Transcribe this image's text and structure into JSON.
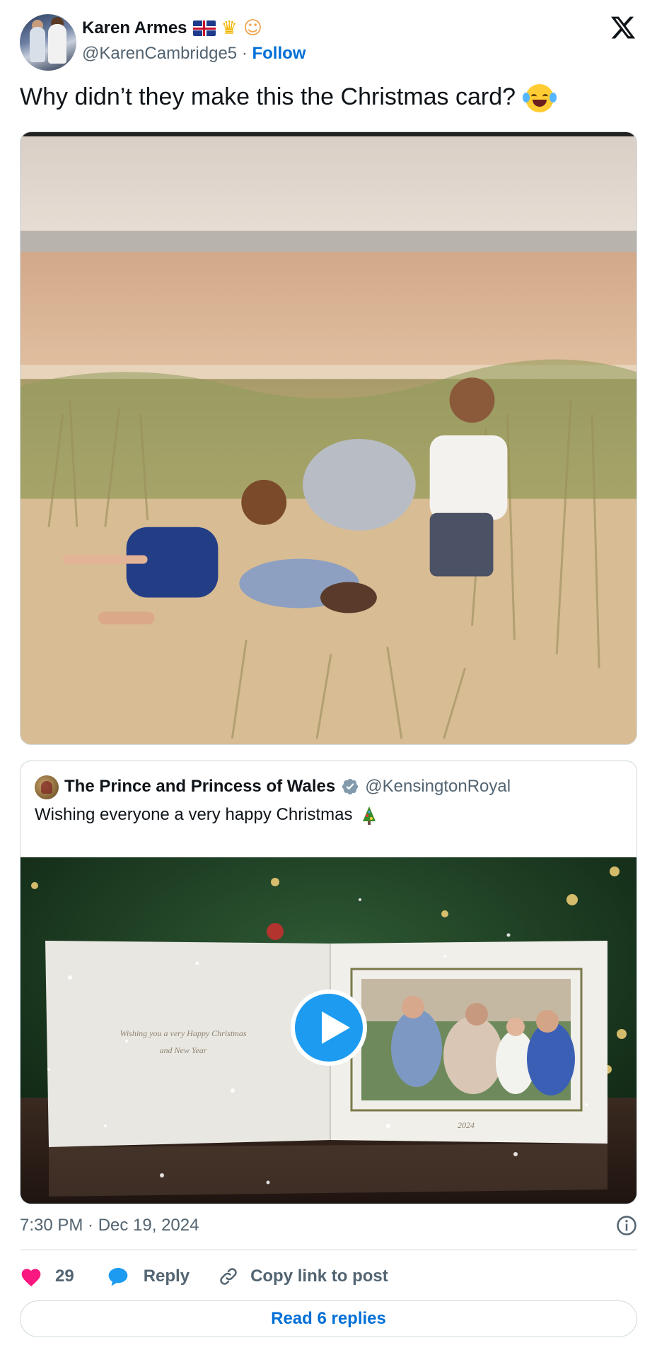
{
  "author": {
    "name": "Karen Armes",
    "handle": "@KarenCambridge5",
    "separator": "·",
    "follow_label": "Follow"
  },
  "tweet": {
    "text": "Why didn’t they make this the Christmas card?"
  },
  "quoted": {
    "name": "The Prince and Princess of Wales",
    "handle": "@KensingtonRoyal",
    "text": "Wishing everyone a very happy Christmas",
    "card_text_line1": "Wishing you a very Happy Christmas",
    "card_text_line2": "and New Year",
    "card_year": "2024"
  },
  "footer": {
    "timestamp": "7:30 PM · Dec 19, 2024",
    "like_count": "29",
    "reply_label": "Reply",
    "copy_label": "Copy link to post",
    "read_replies_label": "Read 6 replies"
  },
  "colors": {
    "accent": "#006fd6",
    "like": "#f91880",
    "reply": "#1d9bf0",
    "muted": "#536471",
    "border": "#cfd9de"
  },
  "icons": [
    "x-logo-icon",
    "uk-flag-icon",
    "crown-icon",
    "princess-icon",
    "laughing-emoji-icon",
    "verified-icon",
    "christmas-tree-icon",
    "play-icon",
    "info-icon",
    "heart-icon",
    "reply-bubble-icon",
    "link-icon"
  ]
}
